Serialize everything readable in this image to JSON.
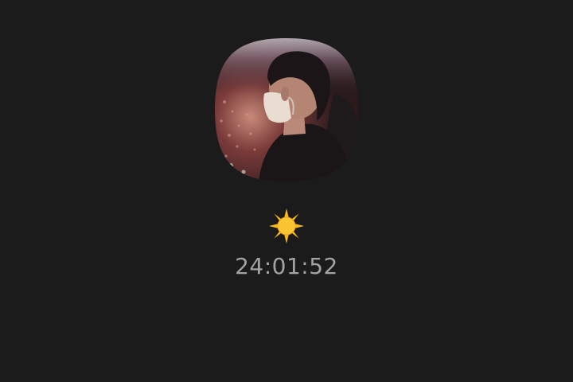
{
  "profile": {
    "photo_subject": "person-wearing-mask-in-stadium-crowd"
  },
  "status": {
    "emoji_icon": "sun-icon",
    "emoji_color": "#f7c21b"
  },
  "timer": {
    "value": "24:01:52"
  },
  "colors": {
    "background": "#1b1b1c",
    "timer_text": "#a3a3a3"
  }
}
